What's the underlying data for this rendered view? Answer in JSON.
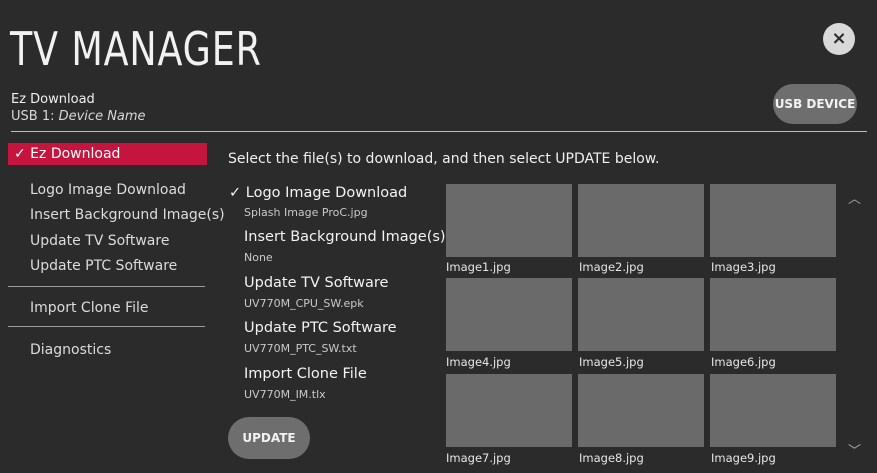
{
  "header": {
    "title": "TV MANAGER",
    "close_icon": "×",
    "mode_label": "Ez Download",
    "usb_prefix": "USB 1: ",
    "usb_device_name": "Device Name",
    "usb_device_button": "USB DEVICE"
  },
  "sidebar": {
    "selected_label": "✓ Ez Download",
    "items": [
      "Logo Image Download",
      "Insert Background Image(s)",
      "Update TV Software",
      "Update PTC Software",
      "Import Clone File",
      "Diagnostics"
    ]
  },
  "main": {
    "instruction": "Select the file(s) to download, and then select UPDATE below.",
    "options": [
      {
        "title": "✓ Logo Image Download",
        "file": "Splash Image ProC.jpg"
      },
      {
        "title": "Insert Background Image(s)",
        "file": "None"
      },
      {
        "title": "Update TV Software",
        "file": "UV770M_CPU_SW.epk"
      },
      {
        "title": "Update PTC Software",
        "file": "UV770M_PTC_SW.txt"
      },
      {
        "title": "Import Clone File",
        "file": "UV770M_IM.tlx"
      }
    ],
    "update_button": "UPDATE",
    "thumbnails": [
      "Image1.jpg",
      "Image2.jpg",
      "Image3.jpg",
      "Image4.jpg",
      "Image5.jpg",
      "Image6.jpg",
      "Image7.jpg",
      "Image8.jpg",
      "Image9.jpg"
    ],
    "scroll_up_icon": "︿",
    "scroll_down_icon": "﹀"
  }
}
